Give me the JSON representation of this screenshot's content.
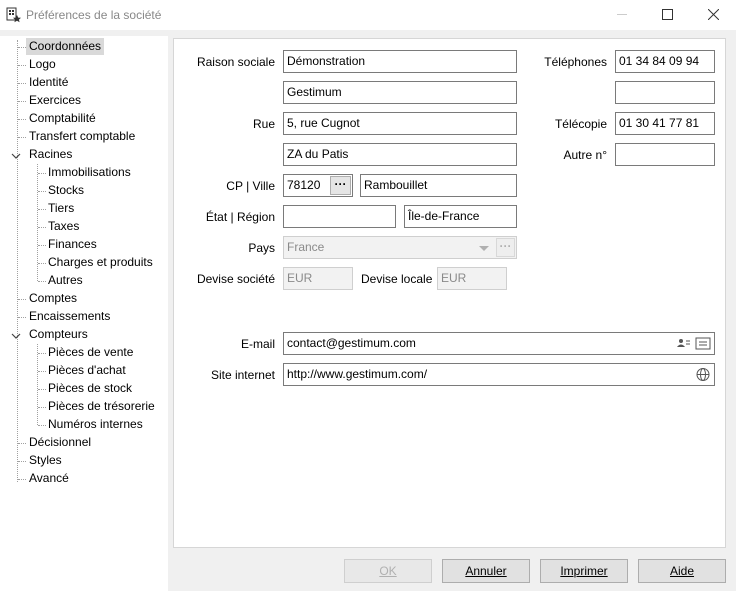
{
  "window": {
    "title": "Préférences de la société"
  },
  "tree": {
    "items": [
      {
        "label": "Coordonnées"
      },
      {
        "label": "Logo"
      },
      {
        "label": "Identité"
      },
      {
        "label": "Exercices"
      },
      {
        "label": "Comptabilité"
      },
      {
        "label": "Transfert comptable"
      },
      {
        "label": "Racines"
      },
      {
        "label": "Immobilisations"
      },
      {
        "label": "Stocks"
      },
      {
        "label": "Tiers"
      },
      {
        "label": "Taxes"
      },
      {
        "label": "Finances"
      },
      {
        "label": "Charges et produits"
      },
      {
        "label": "Autres"
      },
      {
        "label": "Comptes"
      },
      {
        "label": "Encaissements"
      },
      {
        "label": "Compteurs"
      },
      {
        "label": "Pièces de vente"
      },
      {
        "label": "Pièces d'achat"
      },
      {
        "label": "Pièces de stock"
      },
      {
        "label": "Pièces de trésorerie"
      },
      {
        "label": "Numéros internes"
      },
      {
        "label": "Décisionnel"
      },
      {
        "label": "Styles"
      },
      {
        "label": "Avancé"
      }
    ]
  },
  "form": {
    "raison_sociale_label": "Raison sociale",
    "raison_sociale_1": "Démonstration",
    "raison_sociale_2": "Gestimum",
    "rue_label": "Rue",
    "rue_1": "5, rue Cugnot",
    "rue_2": "ZA du Patis",
    "cp_ville_label": "CP | Ville",
    "cp": "78120",
    "cp_button": "···",
    "ville": "Rambouillet",
    "etat_region_label": "État | Région",
    "etat": "",
    "region": "Île-de-France",
    "pays_label": "Pays",
    "pays": "France",
    "pays_button": "···",
    "devise_societe_label": "Devise société",
    "devise_societe": "EUR",
    "devise_locale_label": "Devise locale",
    "devise_locale": "EUR",
    "telephones_label": "Téléphones",
    "telephone_1": "01 34 84 09 94",
    "telephone_2": "",
    "telecopie_label": "Télécopie",
    "telecopie": "01 30 41 77 81",
    "autre_label": "Autre n°",
    "autre": "",
    "email_label": "E-mail",
    "email": "contact@gestimum.com",
    "site_label": "Site internet",
    "site": "http://www.gestimum.com/"
  },
  "buttons": {
    "ok": "OK",
    "annuler": "Annuler",
    "imprimer": "Imprimer",
    "aide": "Aide"
  }
}
